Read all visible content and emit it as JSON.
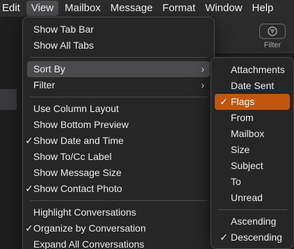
{
  "menubar": {
    "items": [
      "Edit",
      "View",
      "Mailbox",
      "Message",
      "Format",
      "Window",
      "Help"
    ],
    "active": "View"
  },
  "toolbar": {
    "filter_label": "Filter",
    "filter_icon": "filter-icon"
  },
  "view_menu": {
    "groups": [
      [
        {
          "label": "Show Tab Bar"
        },
        {
          "label": "Show All Tabs"
        }
      ],
      [
        {
          "label": "Sort By",
          "submenu": true,
          "highlighted": true
        },
        {
          "label": "Filter",
          "submenu": true
        }
      ],
      [
        {
          "label": "Use Column Layout"
        },
        {
          "label": "Show Bottom Preview"
        },
        {
          "label": "Show Date and Time",
          "checked": true
        },
        {
          "label": "Show To/Cc Label"
        },
        {
          "label": "Show Message Size"
        },
        {
          "label": "Show Contact Photo",
          "checked": true
        }
      ],
      [
        {
          "label": "Highlight Conversations"
        },
        {
          "label": "Organize by Conversation",
          "checked": true
        },
        {
          "label": "Expand All Conversations"
        }
      ]
    ]
  },
  "sort_menu": {
    "groups": [
      [
        {
          "label": "Attachments"
        },
        {
          "label": "Date Sent"
        },
        {
          "label": "Flags",
          "checked": true,
          "highlighted": true
        },
        {
          "label": "From"
        },
        {
          "label": "Mailbox"
        },
        {
          "label": "Size"
        },
        {
          "label": "Subject"
        },
        {
          "label": "To"
        },
        {
          "label": "Unread"
        }
      ],
      [
        {
          "label": "Ascending"
        },
        {
          "label": "Descending",
          "checked": true
        }
      ]
    ]
  },
  "colors": {
    "highlight_orange": "#c0560f",
    "highlight_gray": "#4b4b4d"
  },
  "glyphs": {
    "check": "✓",
    "chevron": "›"
  }
}
